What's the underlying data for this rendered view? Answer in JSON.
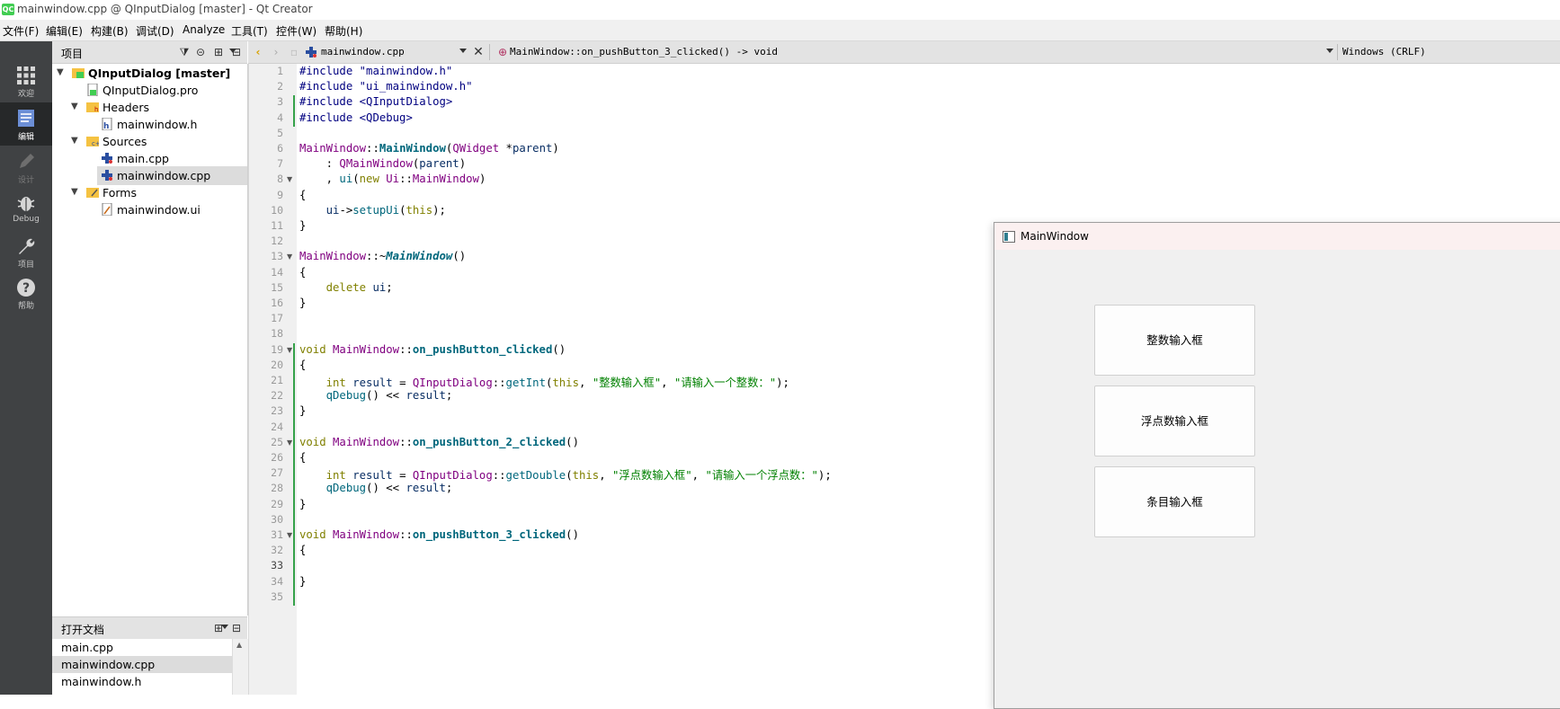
{
  "window": {
    "title": "mainwindow.cpp @ QInputDialog [master] - Qt Creator",
    "logo": "QC"
  },
  "menubar": [
    "文件(F)",
    "编辑(E)",
    "构建(B)",
    "调试(D)",
    "Analyze",
    "工具(T)",
    "控件(W)",
    "帮助(H)"
  ],
  "modes": [
    {
      "icon": "grid-icon",
      "label": "欢迎"
    },
    {
      "icon": "edit-doc-icon",
      "label": "编辑"
    },
    {
      "icon": "pencil-icon",
      "label": "设计"
    },
    {
      "icon": "bug-icon",
      "label": "Debug"
    },
    {
      "icon": "wrench-icon",
      "label": "项目"
    },
    {
      "icon": "help-icon",
      "label": "帮助"
    }
  ],
  "project_pane": {
    "title": "项目",
    "tree": [
      {
        "label": "QInputDialog [master]",
        "icon": "project-icon"
      },
      {
        "label": "QInputDialog.pro",
        "icon": "pro-file-icon"
      },
      {
        "label": "Headers",
        "icon": "folder-headers-icon"
      },
      {
        "label": "mainwindow.h",
        "icon": "header-file-icon"
      },
      {
        "label": "Sources",
        "icon": "folder-sources-icon"
      },
      {
        "label": "main.cpp",
        "icon": "cpp-file-icon"
      },
      {
        "label": "mainwindow.cpp",
        "icon": "cpp-file-icon"
      },
      {
        "label": "Forms",
        "icon": "folder-forms-icon"
      },
      {
        "label": "mainwindow.ui",
        "icon": "ui-file-icon"
      }
    ]
  },
  "open_docs": {
    "title": "打开文档",
    "items": [
      "main.cpp",
      "mainwindow.cpp",
      "mainwindow.h"
    ]
  },
  "editor_toolbar": {
    "file": "mainwindow.cpp",
    "function": "MainWindow::on_pushButton_3_clicked() -> void",
    "encoding": "Windows (CRLF)"
  },
  "editor": {
    "current_line": 33,
    "lines": [
      "#include \"mainwindow.h\"",
      "#include \"ui_mainwindow.h\"",
      "#include <QInputDialog>",
      "#include <QDebug>",
      "",
      "MainWindow::MainWindow(QWidget *parent)",
      "    : QMainWindow(parent)",
      "    , ui(new Ui::MainWindow)",
      "{",
      "    ui->setupUi(this);",
      "}",
      "",
      "MainWindow::~MainWindow()",
      "{",
      "    delete ui;",
      "}",
      "",
      "",
      "void MainWindow::on_pushButton_clicked()",
      "{",
      "    int result = QInputDialog::getInt(this, \"整数输入框\", \"请输入一个整数：\");",
      "    qDebug() << result;",
      "}",
      "",
      "void MainWindow::on_pushButton_2_clicked()",
      "{",
      "    int result = QInputDialog::getDouble(this, \"浮点数输入框\", \"请输入一个浮点数：\");",
      "    qDebug() << result;",
      "}",
      "",
      "void MainWindow::on_pushButton_3_clicked()",
      "{",
      "",
      "}",
      ""
    ]
  },
  "app_window": {
    "title": "MainWindow",
    "buttons": [
      "整数输入框",
      "浮点数输入框",
      "条目输入框"
    ]
  }
}
